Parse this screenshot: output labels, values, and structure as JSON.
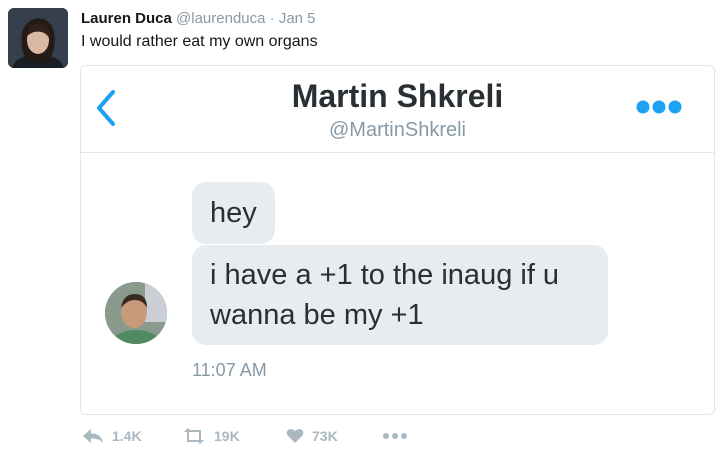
{
  "tweet": {
    "author_name": "Lauren Duca",
    "author_handle": "@laurenduca",
    "separator": "·",
    "date": "Jan 5",
    "text": "I would rather eat my own organs"
  },
  "dm": {
    "name": "Martin Shkreli",
    "handle": "@MartinShkreli",
    "messages": [
      {
        "text": "hey"
      },
      {
        "text": "i have a +1 to the inaug if u wanna be my +1"
      }
    ],
    "timestamp": "11:07 AM"
  },
  "actions": {
    "reply_count": "1.4K",
    "retweet_count": "19K",
    "like_count": "73K"
  },
  "colors": {
    "accent": "#1da1f2",
    "bubble": "#e6ecf0",
    "muted": "#8899a6",
    "action": "#aab8c2"
  }
}
